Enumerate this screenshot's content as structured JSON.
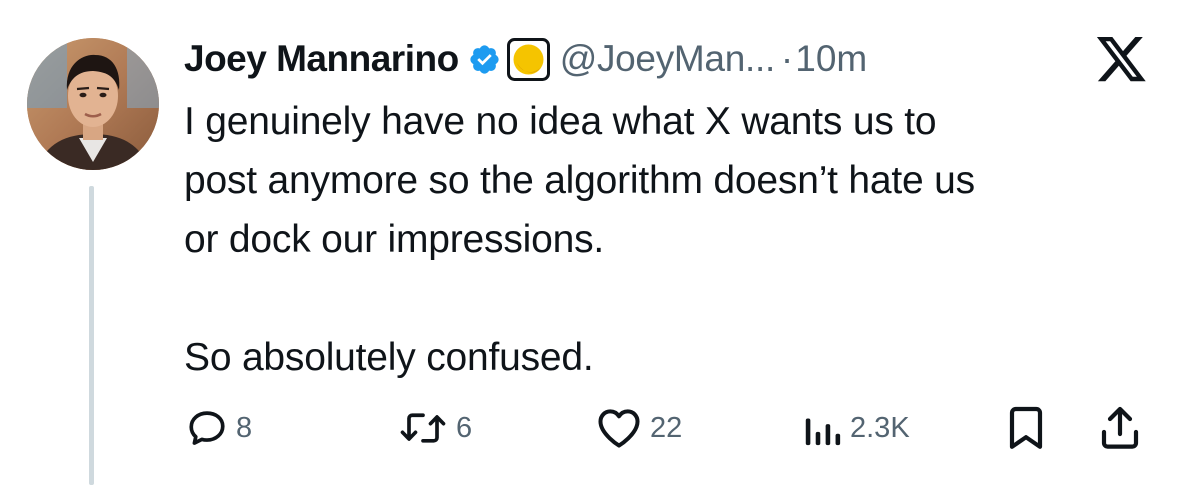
{
  "author": {
    "name": "Joey Mannarino",
    "handle": "@JoeyMan...",
    "separator": "·",
    "time": "10m"
  },
  "tweet": {
    "lines": [
      "I genuinely have no idea what X wants us to",
      "post anymore so the algorithm doesn’t hate us",
      "or dock our impressions."
    ],
    "closing": "So absolutely confused."
  },
  "actions": {
    "replies": "8",
    "reposts": "6",
    "likes": "22",
    "views": "2.3K"
  },
  "colors": {
    "text": "#0f1419",
    "secondary": "#536471",
    "verified_blue": "#1d9bf0",
    "thread_line": "#cfd9de",
    "affiliate_yellow": "#f5c400"
  },
  "icons": [
    "avatar",
    "verified-badge-icon",
    "affiliate-badge-icon",
    "x-logo-icon",
    "reply-icon",
    "repost-icon",
    "like-icon",
    "views-icon",
    "bookmark-icon",
    "share-icon"
  ]
}
